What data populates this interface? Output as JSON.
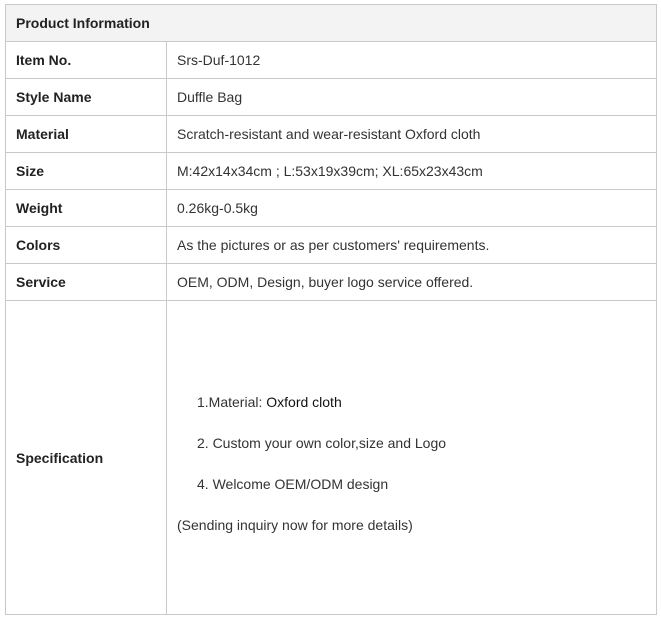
{
  "table": {
    "header": "Product Information",
    "rows": [
      {
        "label": "Item No.",
        "value": "Srs-Duf-1012"
      },
      {
        "label": "Style Name",
        "value": "Duffle Bag"
      },
      {
        "label": "Material",
        "value": "Scratch-resistant and wear-resistant Oxford cloth"
      },
      {
        "label": "Size",
        "value": "M:42x14x34cm ; L:53x19x39cm; XL:65x23x43cm"
      },
      {
        "label": "Weight",
        "value": "0.26kg-0.5kg"
      },
      {
        "label": "Colors",
        "value": "As the pictures or as per customers' requirements."
      },
      {
        "label": "Service",
        "value": "OEM, ODM, Design, buyer logo service offered."
      }
    ],
    "specification": {
      "label": "Specification",
      "item1_prefix": "1.Material: ",
      "item1_value": "Oxford cloth",
      "item2": "2. Custom your own color,size and Logo",
      "item3": "4. Welcome OEM/ODM design",
      "note": "(Sending inquiry now for more details)"
    }
  }
}
